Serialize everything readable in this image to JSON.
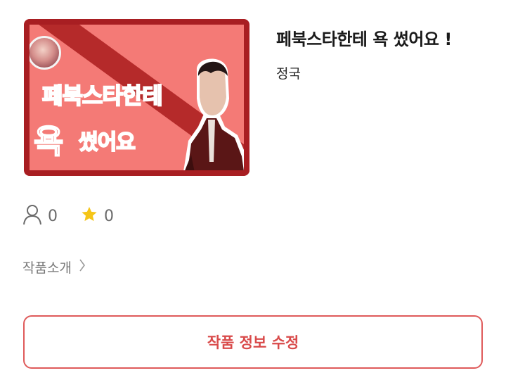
{
  "work": {
    "title": "페북스타한테 욕 썼어요 !",
    "author": "정국",
    "cover": {
      "line1": "페북스타한테",
      "line2_big": "욕",
      "line2": "썼어요",
      "accent_color": "#e02222",
      "background_color": "#f47a76",
      "frame_color": "#a81e22"
    }
  },
  "stats": {
    "readers_icon": "person-icon",
    "readers": "0",
    "stars_icon": "star-icon",
    "stars": "0",
    "star_color": "#f5c518"
  },
  "intro": {
    "label": "작품소개",
    "icon": "chevron-right-icon"
  },
  "actions": {
    "edit_label": "작품 정보 수정",
    "accent_color": "#d94a4a"
  }
}
